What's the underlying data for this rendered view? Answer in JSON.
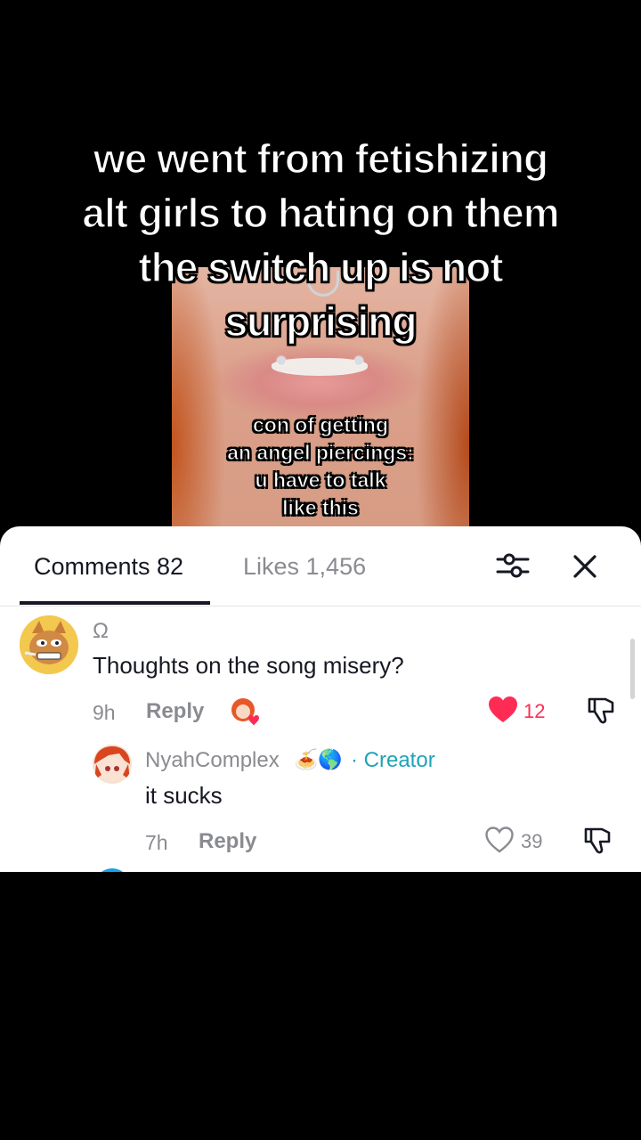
{
  "video": {
    "caption": "we went from fetishizing alt girls to hating on them the switch up is not surprising",
    "caption_lines": [
      "we went from fetishizing",
      "alt girls to hating on them",
      "the switch up is not",
      "surprising"
    ],
    "inner_caption_lines": [
      "con of getting",
      "an angel piercings:",
      "u have to talk",
      "like this"
    ]
  },
  "tabs": {
    "comments_label": "Comments 82",
    "likes_label": "Likes 1,456"
  },
  "comments": [
    {
      "username": "Ω",
      "text": "Thoughts on the song misery?",
      "time": "9h",
      "reply_label": "Reply",
      "likes": "12",
      "liked": true
    },
    {
      "username": "NyahComplex",
      "badge": "· Creator",
      "text": "it sucks",
      "time": "7h",
      "reply_label": "Reply",
      "likes": "39",
      "liked": false
    }
  ],
  "colors": {
    "like_active": "#fe2c55",
    "creator": "#20a3b7",
    "muted": "#8a8b91"
  },
  "icons": [
    "filter-icon",
    "close-icon",
    "heart-filled-icon",
    "heart-outline-icon",
    "dislike-icon",
    "emoji-icon"
  ]
}
